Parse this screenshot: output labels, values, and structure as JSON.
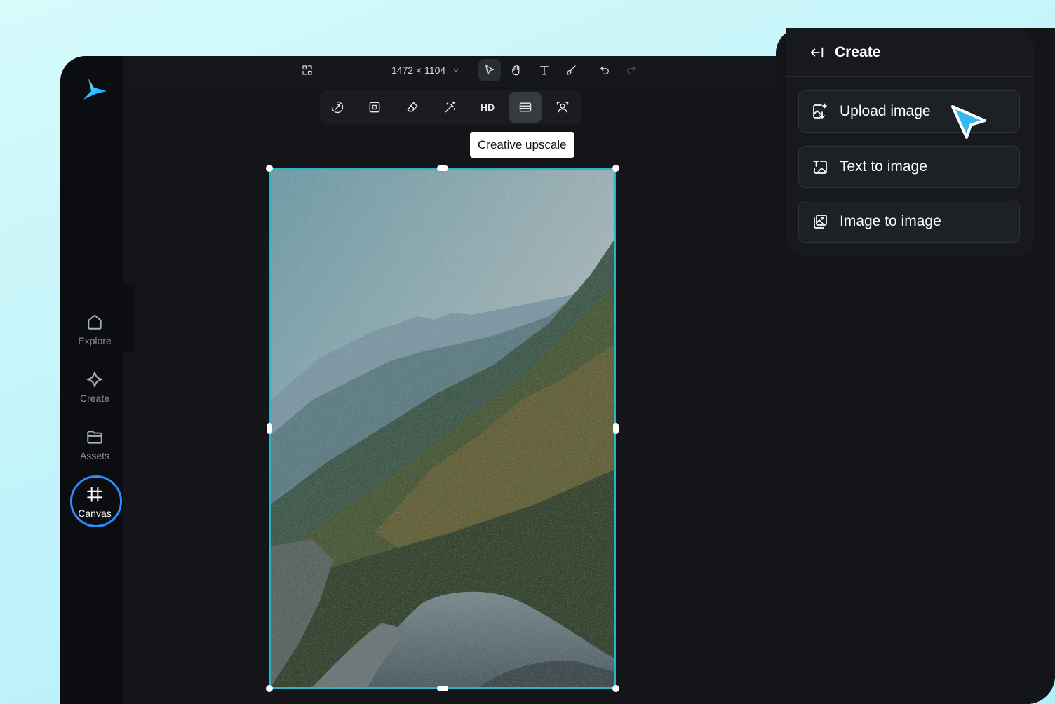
{
  "colors": {
    "accent": "#2f8cff",
    "selection": "#2bb4c4",
    "panel": "#17191e",
    "app_bg": "#131519"
  },
  "sidebar": {
    "logo": "brand-logo",
    "items": [
      {
        "label": "Explore",
        "icon": "home-icon"
      },
      {
        "label": "Create",
        "icon": "sparkle-icon"
      },
      {
        "label": "Assets",
        "icon": "folder-icon"
      },
      {
        "label": "Canvas",
        "icon": "frame-icon",
        "active": true
      }
    ]
  },
  "topbar": {
    "canvas_size": "1472 × 1104",
    "tools": [
      "resize-icon",
      "select-arrow-icon",
      "hand-icon",
      "text-icon",
      "brush-icon",
      "undo-icon",
      "redo-icon"
    ]
  },
  "image_tools": {
    "items": [
      "remove-background-icon",
      "crop-icon",
      "eraser-icon",
      "magic-wand-icon",
      "HD",
      "creative-upscale-icon",
      "face-enhance-icon"
    ],
    "hd_label": "HD",
    "tooltip": "Creative upscale"
  },
  "panel": {
    "title": "Create",
    "options": [
      {
        "label": "Upload image",
        "icon": "upload-image-icon"
      },
      {
        "label": "Text to image",
        "icon": "text-to-image-icon"
      },
      {
        "label": "Image to image",
        "icon": "image-to-image-icon"
      }
    ]
  }
}
